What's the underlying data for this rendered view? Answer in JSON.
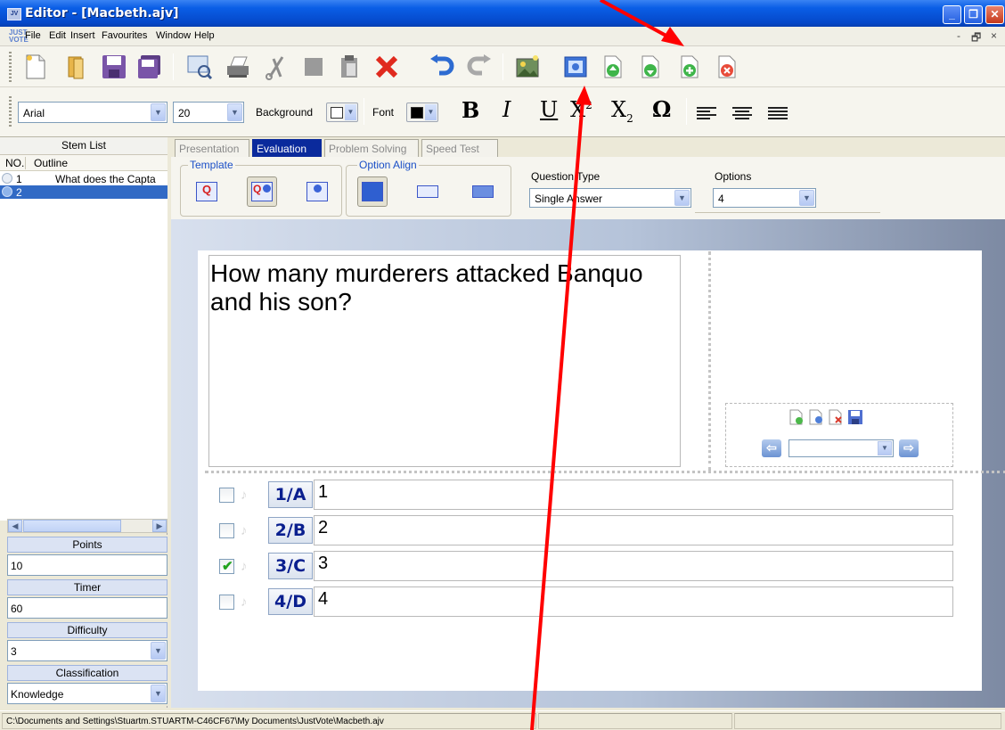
{
  "window": {
    "title": "Editor - [Macbeth.ajv]",
    "icon_text": "JV",
    "buttons": {
      "minimize": "_",
      "restore": "❐",
      "close": "✕"
    }
  },
  "menu": {
    "items": [
      "File",
      "Edit",
      "Insert",
      "Favourites",
      "Window",
      "Help"
    ],
    "mdi_controls": [
      "-",
      "🗗",
      "×"
    ]
  },
  "toolbar": {
    "icons": [
      "new-icon",
      "open-icon",
      "save-icon",
      "save-all-icon",
      "preview-icon",
      "print-icon",
      "cut-icon",
      "copy-icon",
      "paste-icon",
      "delete-icon",
      "undo-icon",
      "redo-icon",
      "image-icon",
      "media-icon",
      "move-up-icon",
      "move-down-icon",
      "add-icon",
      "remove-icon"
    ]
  },
  "format": {
    "font_name": "Arial",
    "font_size": "20",
    "background_label": "Background",
    "font_label": "Font",
    "bold": "B",
    "italic": "I",
    "underline": "U",
    "superscript_base": "X",
    "superscript_mark": "2",
    "subscript_base": "X",
    "subscript_mark": "2",
    "symbol": "Ω"
  },
  "stem_list": {
    "title": "Stem List",
    "col_no": "NO.",
    "col_outline": "Outline",
    "rows": [
      {
        "no": "1",
        "outline": "What does the Capta"
      },
      {
        "no": "2",
        "outline": ""
      }
    ]
  },
  "properties": {
    "points_label": "Points",
    "points": "10",
    "timer_label": "Timer",
    "timer": "60",
    "difficulty_label": "Difficulty",
    "difficulty": "3",
    "classification_label": "Classification",
    "classification": "Knowledge"
  },
  "tabs": [
    "Presentation",
    "Evaluation",
    "Problem Solving",
    "Speed Test"
  ],
  "active_tab": "Evaluation",
  "settings": {
    "template_label": "Template",
    "option_align_label": "Option Align",
    "question_type_label": "Question Type",
    "question_type": "Single Answer",
    "options_label": "Options",
    "options": "4"
  },
  "question": {
    "text": "How many murderers attacked Banquo and his son?"
  },
  "answers": [
    {
      "letter": "1/A",
      "text": "1",
      "checked": false
    },
    {
      "letter": "2/B",
      "text": "2",
      "checked": false
    },
    {
      "letter": "3/C",
      "text": "3",
      "checked": true
    },
    {
      "letter": "4/D",
      "text": "4",
      "checked": false
    }
  ],
  "status": {
    "path": "C:\\Documents and Settings\\Stuartm.STUARTM-C46CF67\\My Documents\\JustVote\\Macbeth.ajv"
  },
  "colors": {
    "title_bar": "#0548c9",
    "active_tab": "#0a2a9c",
    "selection": "#316ac5",
    "annotation_arrow": "#ff0000",
    "answer_letter": "#0a1f8f"
  }
}
